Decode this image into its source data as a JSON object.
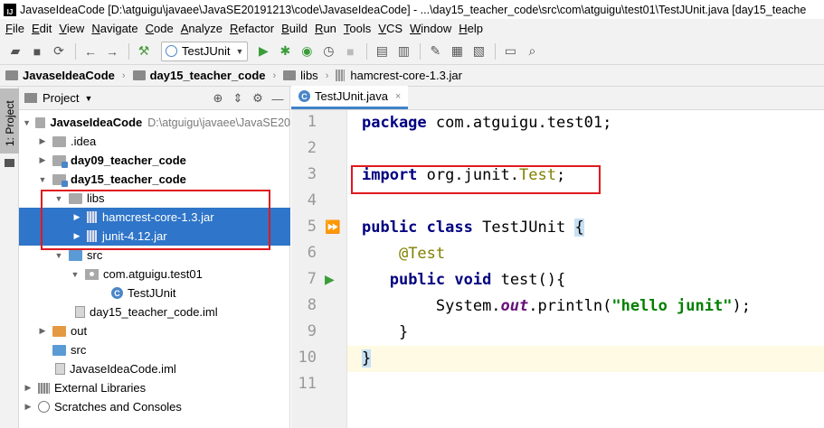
{
  "window": {
    "title": "JavaseIdeaCode [D:\\atguigu\\javaee\\JavaSE20191213\\code\\JavaseIdeaCode] - ...\\day15_teacher_code\\src\\com\\atguigu\\test01\\TestJUnit.java [day15_teache"
  },
  "menu": [
    "File",
    "Edit",
    "View",
    "Navigate",
    "Code",
    "Analyze",
    "Refactor",
    "Build",
    "Run",
    "Tools",
    "VCS",
    "Window",
    "Help"
  ],
  "toolbar": {
    "run_config": "TestJUnit"
  },
  "breadcrumb": [
    "JavaseIdeaCode",
    "day15_teacher_code",
    "libs",
    "hamcrest-core-1.3.jar"
  ],
  "side_tab": {
    "label": "1: Project"
  },
  "project_panel": {
    "title": "Project",
    "tree": [
      {
        "label": "JavaseIdeaCode",
        "path": "D:\\atguigu\\javaee\\JavaSE20"
      },
      {
        "label": ".idea"
      },
      {
        "label": "day09_teacher_code"
      },
      {
        "label": "day15_teacher_code"
      },
      {
        "label": "libs"
      },
      {
        "label": "hamcrest-core-1.3.jar"
      },
      {
        "label": "junit-4.12.jar"
      },
      {
        "label": "src"
      },
      {
        "label": "com.atguigu.test01"
      },
      {
        "label": "TestJUnit"
      },
      {
        "label": "day15_teacher_code.iml"
      },
      {
        "label": "out"
      },
      {
        "label": "src"
      },
      {
        "label": "JavaseIdeaCode.iml"
      },
      {
        "label": "External Libraries"
      },
      {
        "label": "Scratches and Consoles"
      }
    ]
  },
  "editor": {
    "tab": "TestJUnit.java",
    "line_numbers": [
      "1",
      "2",
      "3",
      "4",
      "5",
      "6",
      "7",
      "8",
      "9",
      "10",
      "11"
    ],
    "code": {
      "l1_kw": "package",
      "l1_rest": " com.atguigu.test01;",
      "l3_kw": "import",
      "l3_pkg": " org.junit.",
      "l3_cls": "Test",
      "l3_end": ";",
      "l5_kw1": "public",
      "l5_kw2": "class",
      "l5_name": " TestJUnit ",
      "l5_brace": "{",
      "l6_ann": "@Test",
      "l7_kw1": "public",
      "l7_kw2": "void",
      "l7_rest": " test(){",
      "l8_a": "System.",
      "l8_out": "out",
      "l8_b": ".println(",
      "l8_str": "\"hello junit\"",
      "l8_c": ");",
      "l9": "}",
      "l10": "}"
    }
  },
  "colors": {
    "selection": "#2f75c9",
    "annotation_box": "#e0191e",
    "keyword": "#000080",
    "string": "#008000"
  }
}
